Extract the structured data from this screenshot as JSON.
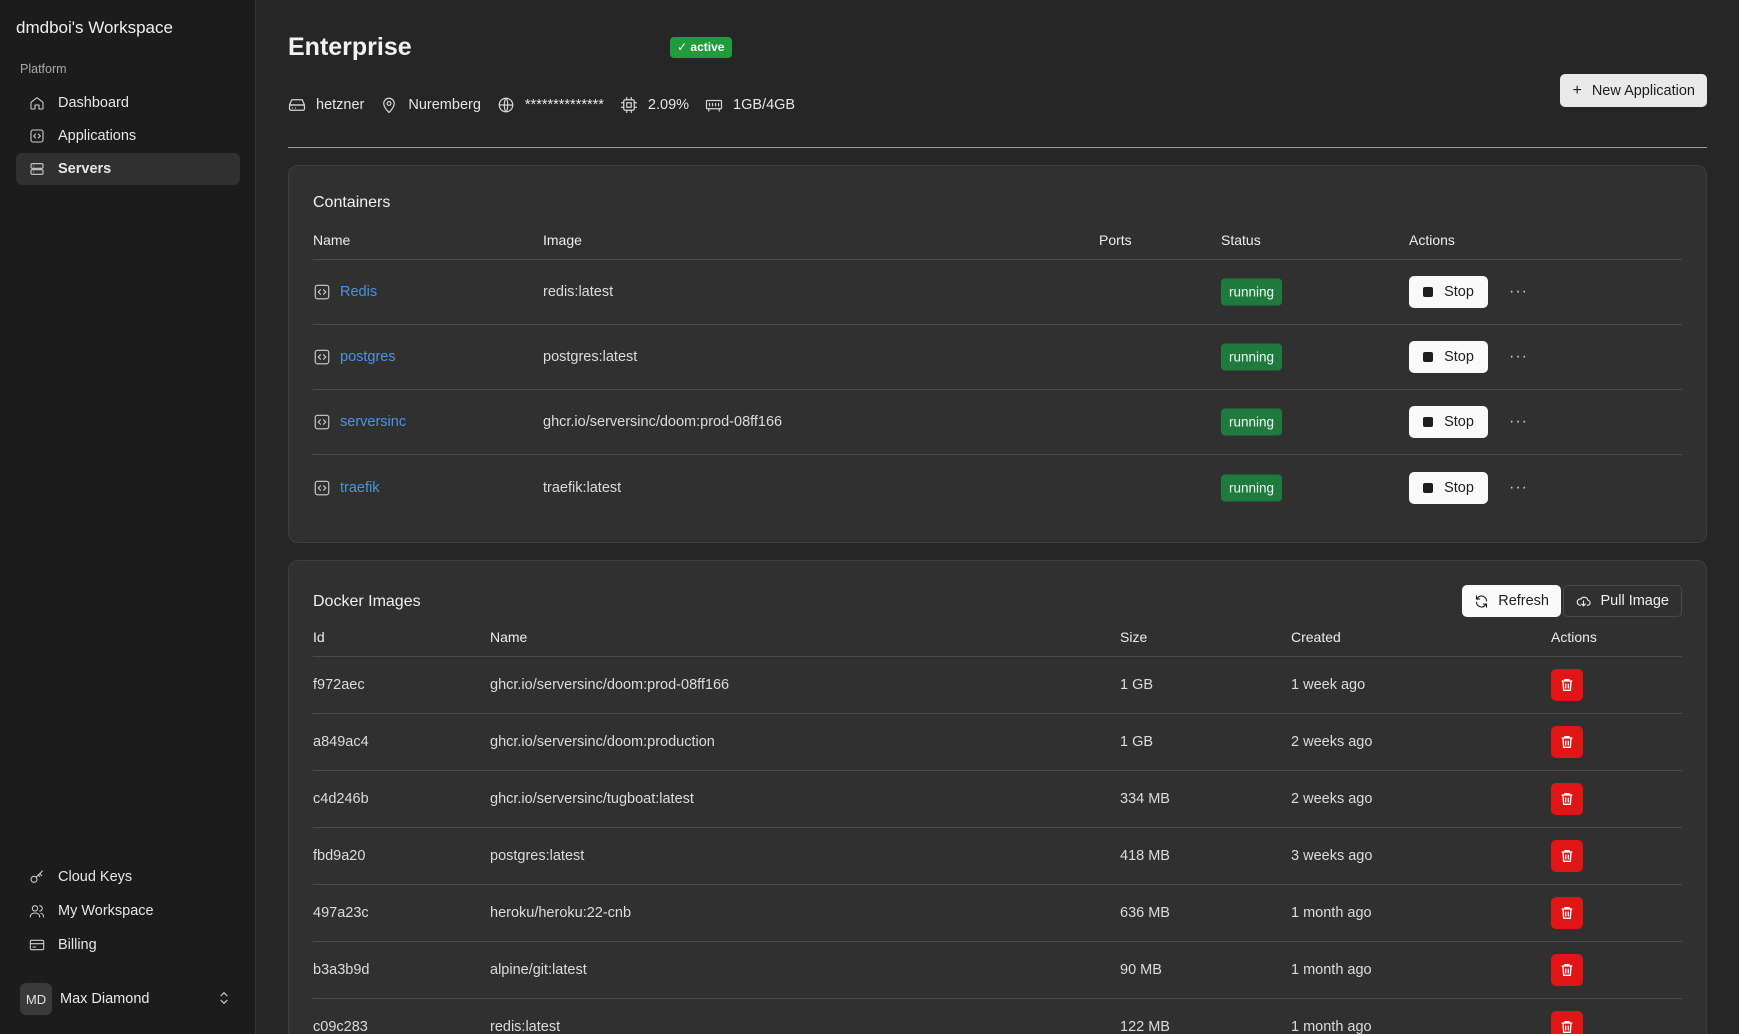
{
  "sidebar": {
    "workspace_title": "dmdboi's Workspace",
    "section_label": "Platform",
    "nav_top": [
      {
        "label": "Dashboard",
        "icon": "home-icon"
      },
      {
        "label": "Applications",
        "icon": "code-box-icon"
      },
      {
        "label": "Servers",
        "icon": "server-icon",
        "active": true
      }
    ],
    "nav_bottom": [
      {
        "label": "Cloud Keys",
        "icon": "key-icon"
      },
      {
        "label": "My Workspace",
        "icon": "users-icon"
      },
      {
        "label": "Billing",
        "icon": "card-icon"
      }
    ],
    "user": {
      "initials": "MD",
      "name": "Max Diamond"
    }
  },
  "header": {
    "title": "Enterprise",
    "status_badge": "active",
    "new_app_label": "New Application",
    "meta": {
      "provider": "hetzner",
      "location": "Nuremberg",
      "ip": "**************",
      "cpu": "2.09%",
      "memory": "1GB/4GB"
    }
  },
  "containers": {
    "title": "Containers",
    "columns": [
      "Name",
      "Image",
      "Ports",
      "Status",
      "Actions"
    ],
    "stop_label": "Stop",
    "rows": [
      {
        "name": "Redis",
        "image": "redis:latest",
        "ports": "",
        "status": "running"
      },
      {
        "name": "postgres",
        "image": "postgres:latest",
        "ports": "",
        "status": "running"
      },
      {
        "name": "serversinc",
        "image": "ghcr.io/serversinc/doom:prod-08ff166",
        "ports": "",
        "status": "running"
      },
      {
        "name": "traefik",
        "image": "traefik:latest",
        "ports": "",
        "status": "running"
      }
    ]
  },
  "images": {
    "title": "Docker Images",
    "refresh_label": "Refresh",
    "pull_label": "Pull Image",
    "columns": [
      "Id",
      "Name",
      "Size",
      "Created",
      "Actions"
    ],
    "rows": [
      {
        "id": "f972aec",
        "name": "ghcr.io/serversinc/doom:prod-08ff166",
        "size": "1 GB",
        "created": "1 week ago"
      },
      {
        "id": "a849ac4",
        "name": "ghcr.io/serversinc/doom:production",
        "size": "1 GB",
        "created": "2 weeks ago"
      },
      {
        "id": "c4d246b",
        "name": "ghcr.io/serversinc/tugboat:latest",
        "size": "334 MB",
        "created": "2 weeks ago"
      },
      {
        "id": "fbd9a20",
        "name": "postgres:latest",
        "size": "418 MB",
        "created": "3 weeks ago"
      },
      {
        "id": "497a23c",
        "name": "heroku/heroku:22-cnb",
        "size": "636 MB",
        "created": "1 month ago"
      },
      {
        "id": "b3a3b9d",
        "name": "alpine/git:latest",
        "size": "90 MB",
        "created": "1 month ago"
      },
      {
        "id": "c09c283",
        "name": "redis:latest",
        "size": "122 MB",
        "created": "1 month ago"
      }
    ]
  },
  "colors": {
    "accent_link": "#4a93e6",
    "status_running": "#1f7a3e",
    "badge_active": "#1f9d3c",
    "delete_red": "#e01515"
  }
}
